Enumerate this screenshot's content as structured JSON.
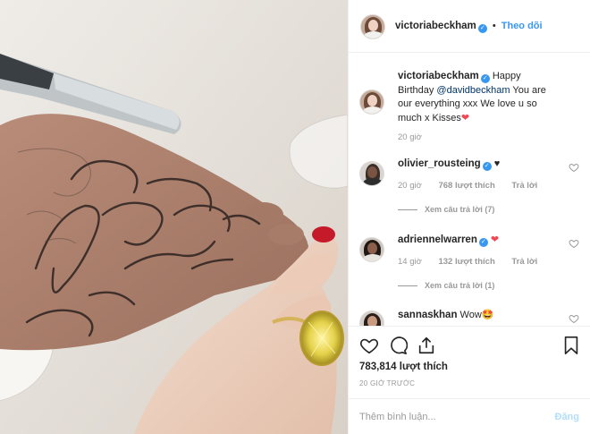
{
  "header": {
    "username": "victoriabeckham",
    "separator": "•",
    "follow_label": "Theo dõi"
  },
  "caption": {
    "username": "victoriabeckham",
    "text_before": "Happy Birthday",
    "mention": "@davidbeckham",
    "text_after": "You are our everything xxx We love u so much x Kisses",
    "emoji": "❤",
    "time": "20 giờ"
  },
  "comments": [
    {
      "username": "olivier_rousteing",
      "text": "♥",
      "time": "20 giờ",
      "likes": "768 lượt thích",
      "reply": "Trả lời",
      "view_replies": "Xem câu trả lời (7)"
    },
    {
      "username": "adriennelwarren",
      "text": "❤",
      "time": "14 giờ",
      "likes": "132 lượt thích",
      "reply": "Trả lời",
      "view_replies": "Xem câu trả lời (1)"
    },
    {
      "username": "sannaskhan",
      "text": "Wow🤩"
    }
  ],
  "actions": {
    "like_icon": "heart-outline-icon",
    "comment_icon": "speech-bubble-icon",
    "share_icon": "share-icon",
    "save_icon": "bookmark-icon"
  },
  "likes_count": "783,814 lượt thích",
  "post_time": "20 GIỜ TRƯỚC",
  "comment_box": {
    "placeholder": "Thêm bình luận...",
    "post_label": "Đăng"
  },
  "colors": {
    "accent": "#3897f0",
    "heart": "#ed4956",
    "post_disabled": "#b2dffc",
    "muted": "#999999"
  }
}
